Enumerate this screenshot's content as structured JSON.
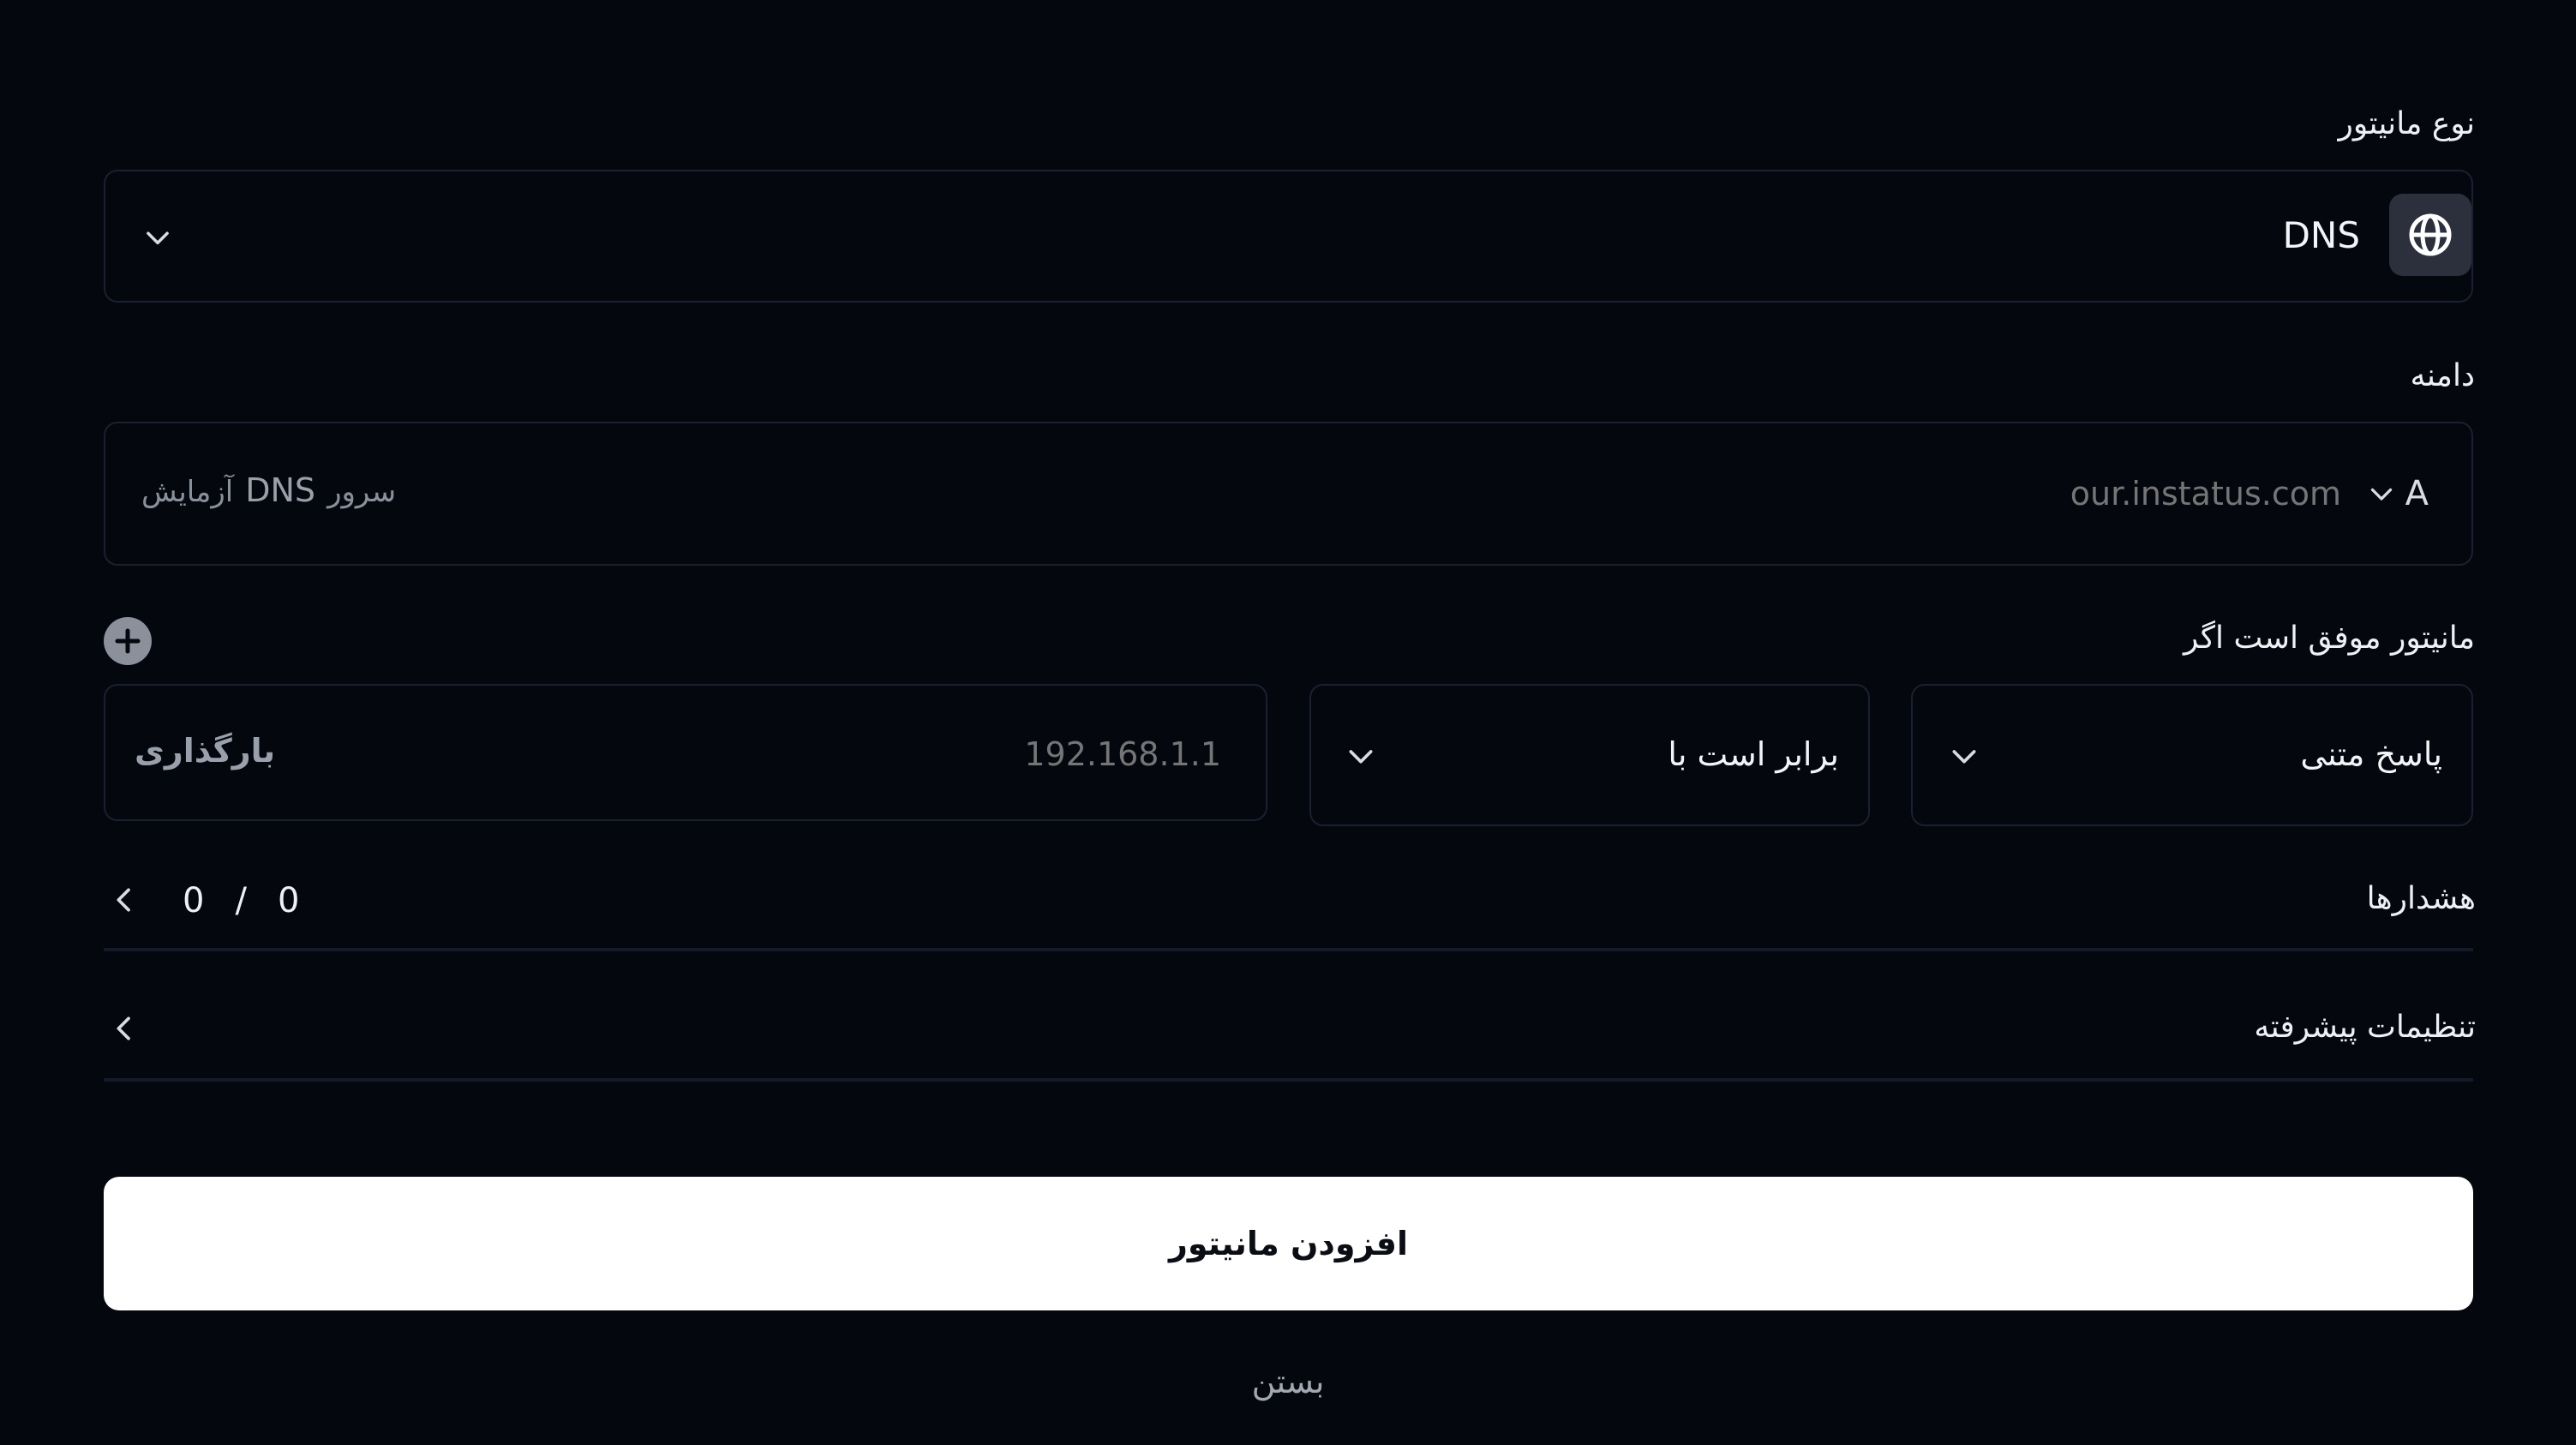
{
  "monitor_type": {
    "label": "نوع مانیتور",
    "value": "DNS",
    "icon": "globe-icon"
  },
  "domain": {
    "label": "دامنه",
    "record_type": "A",
    "placeholder": "our.instatus.com",
    "test_server": {
      "test": "آزمایش",
      "dns": "DNS",
      "server": "سرور"
    }
  },
  "success_condition": {
    "label": "مانیتور موفق است اگر",
    "field": "پاسخ متنی",
    "operator": "برابر است با",
    "value_placeholder": "192.168.1.1",
    "loading": "بارگذاری"
  },
  "alerts": {
    "label": "هشدارها",
    "count_a": "0",
    "sep": "/",
    "count_b": "0"
  },
  "advanced": {
    "label": "تنظیمات پیشرفته"
  },
  "actions": {
    "submit": "افزودن مانیتور",
    "close": "بستن"
  },
  "colors": {
    "background": "#05070f",
    "border": "#1b2030",
    "primary_button": "#ffffff",
    "muted_text": "#7d838f"
  }
}
